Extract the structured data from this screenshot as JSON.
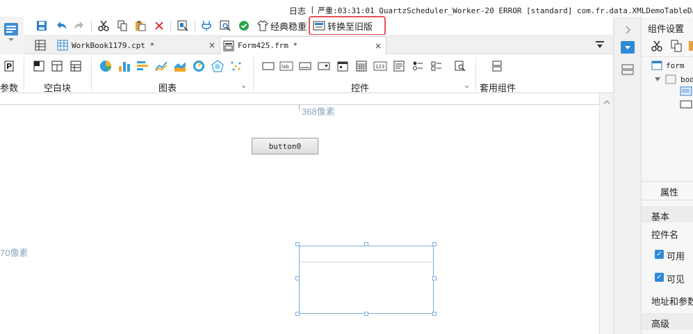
{
  "log": {
    "label": "日志",
    "separator": "|",
    "message": "严重:03:31:01 QuartzScheduler_Worker-20 ERROR [standard] com.fr.data.XMLDemoTableData"
  },
  "toolbar": {
    "classic_stable_label": "经典稳重",
    "convert_old_label": "转换至旧版"
  },
  "tabs": [
    {
      "label": "WorkBook1179.cpt *",
      "close": "×"
    },
    {
      "label": "Form425.frm *",
      "close": "×"
    }
  ],
  "ribbon": {
    "param_label": "参数",
    "blank_block_label": "空白块",
    "chart_label": "图表",
    "widget_label": "控件",
    "template_widget_label": "套用组件",
    "chevron": "⌄"
  },
  "canvas": {
    "width_label": "368像素",
    "height_label": "70像素",
    "button_label": "button0"
  },
  "right_panel": {
    "title": "组件设置",
    "tree": {
      "form": "form",
      "body": "bod"
    },
    "properties_title": "属性",
    "basic_section": "基本",
    "widget_name_label": "控件名",
    "enabled_label": "可用",
    "visible_label": "可见",
    "address_params_label": "地址和参数",
    "advanced_section": "高级"
  },
  "colors": {
    "highlight": "#e8505b",
    "accent_blue": "#2e8ad8",
    "selection": "#7aaee0",
    "dim_label": "#8aa4c0"
  }
}
